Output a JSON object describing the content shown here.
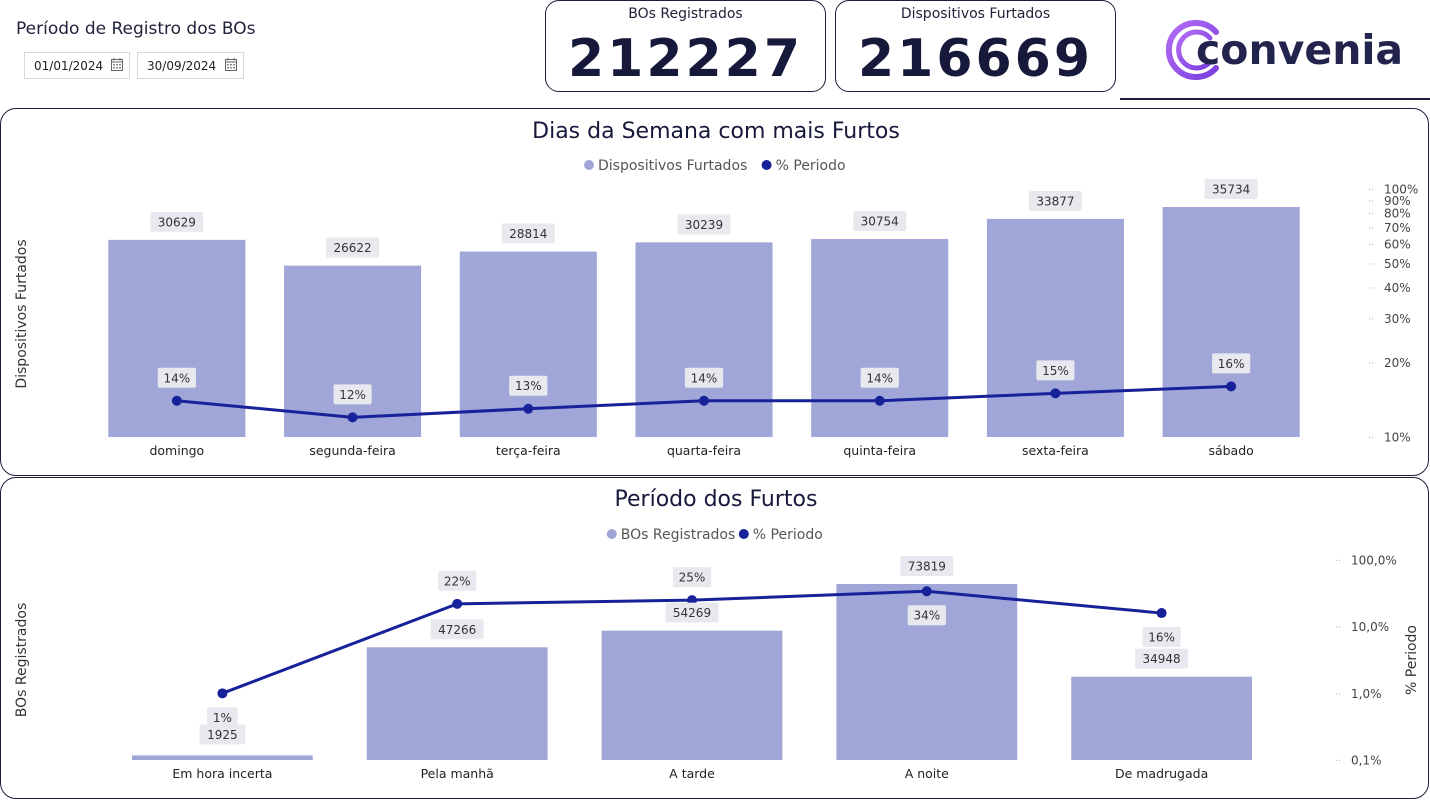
{
  "filter": {
    "title": "Período de Registro dos BOs",
    "start_date": "01/01/2024",
    "end_date": "30/09/2024"
  },
  "kpis": [
    {
      "label": "BOs Registrados",
      "value": "212227"
    },
    {
      "label": "Dispositivos Furtados",
      "value": "216669"
    }
  ],
  "logo": {
    "text": "convenia"
  },
  "colors": {
    "bar": "#a0a6d8",
    "line": "#17229a",
    "label_bg": "#e8e9ee",
    "border": "#1c1f3a"
  },
  "chart_data": [
    {
      "type": "bar",
      "title": "Dias da Semana com mais Furtos",
      "legend": [
        "Dispositivos Furtados",
        "% Periodo"
      ],
      "legend_position": "top-center",
      "ylabel": "Dispositivos Furtados",
      "categories": [
        "domingo",
        "segunda-feira",
        "terça-feira",
        "quarta-feira",
        "quinta-feira",
        "sexta-feira",
        "sábado"
      ],
      "series": [
        {
          "name": "Dispositivos Furtados",
          "type": "bar",
          "values": [
            30629,
            26622,
            28814,
            30239,
            30754,
            33877,
            35734
          ]
        },
        {
          "name": "% Periodo",
          "type": "line",
          "axis": "secondary-log",
          "values": [
            14,
            12,
            13,
            14,
            14,
            15,
            16
          ],
          "labels": [
            "14%",
            "12%",
            "13%",
            "14%",
            "14%",
            "15%",
            "16%"
          ]
        }
      ],
      "secondary_ticks": [
        "100%",
        "90%",
        "80%",
        "70%",
        "60%",
        "50%",
        "40%",
        "30%",
        "20%",
        "10%"
      ],
      "secondary_tick_values": [
        100,
        90,
        80,
        70,
        60,
        50,
        40,
        30,
        20,
        10
      ],
      "y2lim": [
        10,
        100
      ]
    },
    {
      "type": "bar",
      "title": "Período dos Furtos",
      "legend": [
        "BOs Registrados",
        "% Periodo"
      ],
      "legend_position": "top-center",
      "ylabel": "BOs Registrados",
      "y2label": "% Periodo",
      "categories": [
        "Em hora incerta",
        "Pela manhã",
        "A tarde",
        "A noite",
        "De madrugada"
      ],
      "series": [
        {
          "name": "BOs Registrados",
          "type": "bar",
          "values": [
            1925,
            47266,
            54269,
            73819,
            34948
          ]
        },
        {
          "name": "% Periodo",
          "type": "line",
          "axis": "secondary-log",
          "values": [
            1,
            22,
            25,
            34,
            16
          ],
          "labels": [
            "1%",
            "22%",
            "25%",
            "34%",
            "16%"
          ]
        }
      ],
      "secondary_ticks": [
        "100,0%",
        "10,0%",
        "1,0%",
        "0,1%"
      ],
      "secondary_tick_values": [
        100,
        10,
        1,
        0.1
      ],
      "y2lim": [
        0.1,
        100
      ]
    }
  ]
}
